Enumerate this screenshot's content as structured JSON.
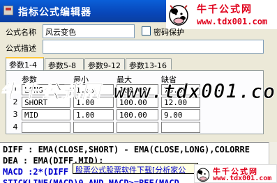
{
  "window": {
    "title": "指标公式编辑器"
  },
  "brand": {
    "name": "牛千公式网",
    "url": "www.tdx001.com"
  },
  "form": {
    "name_label": "公式名称",
    "name_value": "风云变色",
    "password_label": "密码保护",
    "desc_label": "公式描述",
    "desc_value": ""
  },
  "tabs": [
    "参数1-4",
    "参数5-8",
    "参数9-12",
    "参数13-16"
  ],
  "params": {
    "headers": [
      "参数",
      "最小",
      "最大",
      "缺省"
    ],
    "rows": [
      {
        "num": "1",
        "name": "LONG",
        "min": "1.00",
        "max": "100.00",
        "default": "73.00"
      },
      {
        "num": "2",
        "name": "SHORT",
        "min": "1.00",
        "max": "100.00",
        "default": "12.00"
      },
      {
        "num": "3",
        "name": "MID",
        "min": "1.00",
        "max": "100.00",
        "default": "9.00"
      },
      {
        "num": "4",
        "name": "",
        "min": "",
        "max": "",
        "default": ""
      }
    ]
  },
  "watermark": "牛千公式网 www.tdx001.co",
  "code": [
    {
      "text": "DIFF : EMA(CLOSE,SHORT) - EMA(CLOSE,LONG),COLORRE",
      "color": "#000000"
    },
    {
      "text": "DEA  : EMA(DIFF,MID);",
      "color": "#000000"
    },
    {
      "text": "MACD :2*(DIFF",
      "color": "#0000cc"
    },
    {
      "text": "STICKLINE(MACD)0 AND MACD>=REF(MACD",
      "color": "#0000cc"
    }
  ],
  "tooltip": "股票公式股票软件下载[分析家公",
  "colors": {
    "accent_red": "#e0001b",
    "titlebar": "#0a5fd8"
  }
}
